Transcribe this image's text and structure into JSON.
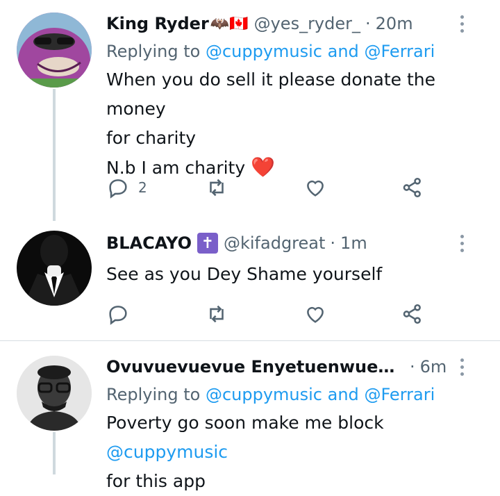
{
  "tweets": [
    {
      "name": "King Ryder",
      "emoji": "🦇🇨🇦",
      "handle": "@yes_ryder_",
      "separator": "·",
      "time": "20m",
      "reply_prefix": "Replying to",
      "reply_user1": "@cuppymusic",
      "reply_and": "and",
      "reply_user2": "@Ferrari",
      "text_line1": "When you do sell it please donate the money",
      "text_line2": "for charity",
      "text_line3": "N.b I am charity",
      "heart_emoji": "❤️",
      "reply_count": "2"
    },
    {
      "name": "BLACAYO",
      "emoji": "✝",
      "handle": "@kifadgreat",
      "separator": "·",
      "time": "1m",
      "text_line1": "See as you Dey Shame yourself"
    },
    {
      "name": "Ovuvuevuevue Enyetuenwuevue Ug...",
      "handle": "",
      "separator": "·",
      "time": "6m",
      "reply_prefix": "Replying to",
      "reply_user1": "@cuppymusic",
      "reply_and": "and",
      "reply_user2": "@Ferrari",
      "text_line1_prefix": "Poverty go soon make me block",
      "text_line1_link": "@cuppymusic",
      "text_line2": "for this app"
    }
  ],
  "colors": {
    "link": "#1d9bf0",
    "muted": "#536471",
    "thread_line": "#cfd9de",
    "heart": "#e0245e"
  },
  "icons": [
    "reply-icon",
    "retweet-icon",
    "like-icon",
    "share-icon",
    "more-icon"
  ]
}
